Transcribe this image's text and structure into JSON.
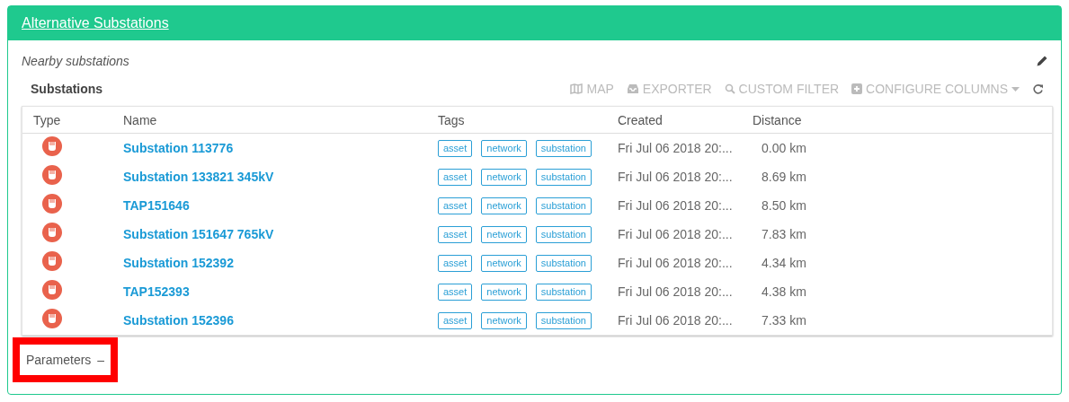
{
  "panel": {
    "title": "Alternative Substations",
    "subtitle": "Nearby substations"
  },
  "table_title": "Substations",
  "toolbar": [
    {
      "kind": "map",
      "label": "MAP"
    },
    {
      "kind": "export",
      "label": "EXPORTER"
    },
    {
      "kind": "search",
      "label": "CUSTOM FILTER"
    },
    {
      "kind": "columns",
      "label": "CONFIGURE COLUMNS"
    },
    {
      "kind": "refresh"
    }
  ],
  "table": {
    "columns": [
      "Type",
      "Name",
      "Tags",
      "Created",
      "Distance"
    ],
    "rows": [
      {
        "name": "Substation 113776",
        "tags": [
          "asset",
          "network",
          "substation"
        ],
        "created": "Fri Jul 06 2018 20:...",
        "distance": "0.00 km"
      },
      {
        "name": "Substation 133821 345kV",
        "tags": [
          "asset",
          "network",
          "substation"
        ],
        "created": "Fri Jul 06 2018 20:...",
        "distance": "8.69 km"
      },
      {
        "name": "TAP151646",
        "tags": [
          "asset",
          "network",
          "substation"
        ],
        "created": "Fri Jul 06 2018 20:...",
        "distance": "8.50 km"
      },
      {
        "name": "Substation 151647 765kV",
        "tags": [
          "asset",
          "network",
          "substation"
        ],
        "created": "Fri Jul 06 2018 20:...",
        "distance": "7.83 km"
      },
      {
        "name": "Substation 152392",
        "tags": [
          "asset",
          "network",
          "substation"
        ],
        "created": "Fri Jul 06 2018 20:...",
        "distance": "4.34 km"
      },
      {
        "name": "TAP152393",
        "tags": [
          "asset",
          "network",
          "substation"
        ],
        "created": "Fri Jul 06 2018 20:...",
        "distance": "4.38 km"
      },
      {
        "name": "Substation 152396",
        "tags": [
          "asset",
          "network",
          "substation"
        ],
        "created": "Fri Jul 06 2018 20:...",
        "distance": "7.33 km"
      }
    ]
  },
  "parameters": {
    "label": "Parameters",
    "toggle": "–",
    "highlighted": true
  }
}
